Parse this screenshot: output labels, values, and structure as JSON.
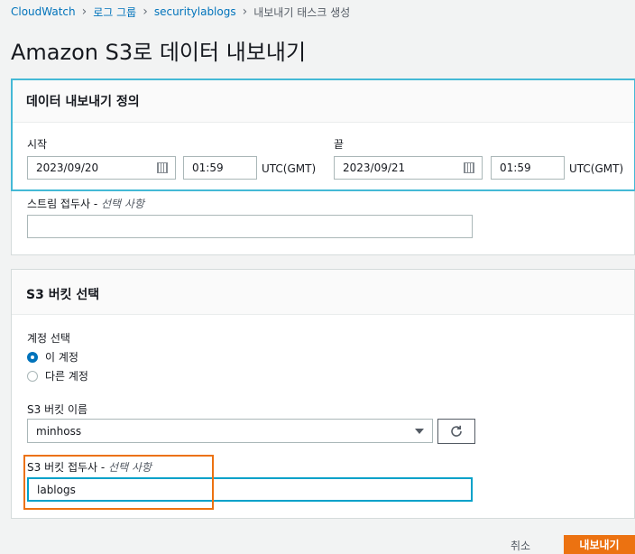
{
  "breadcrumb": [
    "CloudWatch",
    "로그 그룹",
    "securitylablogs",
    "내보내기 태스크 생성"
  ],
  "page_title": "Amazon S3로 데이터 내보내기",
  "export_definition": {
    "title": "데이터 내보내기 정의",
    "start_label": "시작",
    "start_date": "2023/09/20",
    "start_time": "01:59",
    "end_label": "끝",
    "end_date": "2023/09/21",
    "end_time": "01:59",
    "tz": "UTC(GMT)",
    "stream_prefix_label": "스트림 접두사 - ",
    "stream_prefix_optional": "선택 사항",
    "stream_prefix_value": ""
  },
  "s3_bucket": {
    "title": "S3 버킷 선택",
    "account_label": "계정 선택",
    "account_options": [
      "이 계정",
      "다른 계정"
    ],
    "account_selected": "이 계정",
    "bucket_name_label": "S3 버킷 이름",
    "bucket_name": "minhoss",
    "prefix_label": "S3 버킷 접두사 - ",
    "prefix_optional": "선택 사항",
    "prefix_value": "lablogs"
  },
  "footer": {
    "cancel": "취소",
    "submit": "내보내기"
  },
  "colors": {
    "link": "#0073bb",
    "primary": "#ec7211",
    "focus": "#00a1c9",
    "highlight": "#44b9d6"
  }
}
